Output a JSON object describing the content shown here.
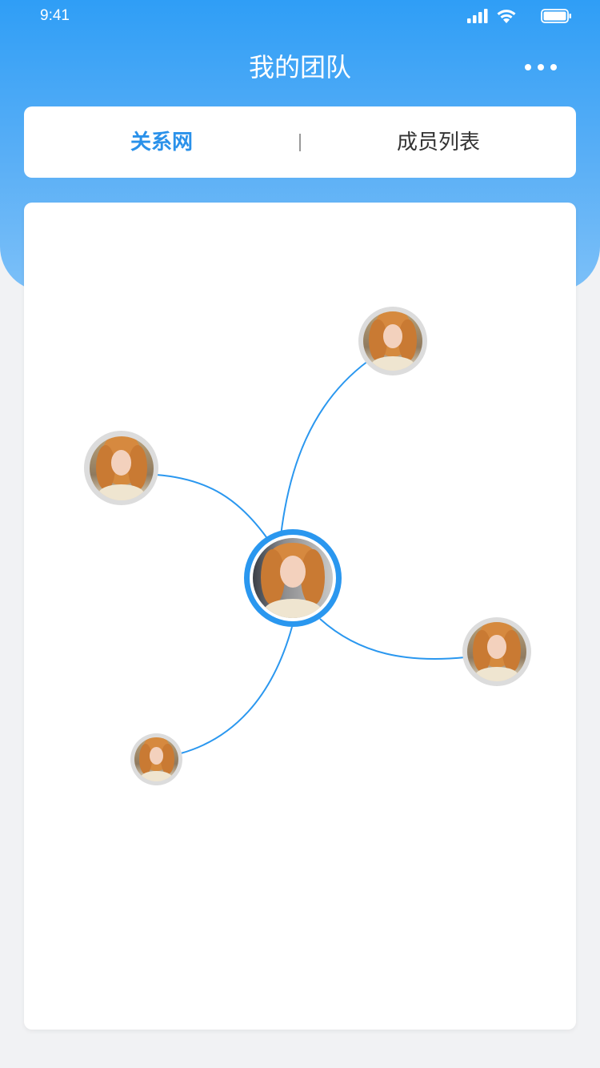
{
  "status_bar": {
    "time": "9:41",
    "icons": [
      "signal-icon",
      "wifi-icon",
      "battery-icon"
    ]
  },
  "header": {
    "title": "我的团队",
    "more_icon": "more-dots-icon"
  },
  "tabs": [
    {
      "label": "关系网",
      "active": true
    },
    {
      "label": "成员列表",
      "active": false
    }
  ],
  "network": {
    "center_avatar": "member-avatar",
    "linked_members_count": 5
  },
  "colors": {
    "primary": "#2a91ea",
    "header_top": "#2f9ef6",
    "header_bottom": "#7cc0f8",
    "line": "#2a97ef",
    "page_bg": "#f1f2f4"
  }
}
